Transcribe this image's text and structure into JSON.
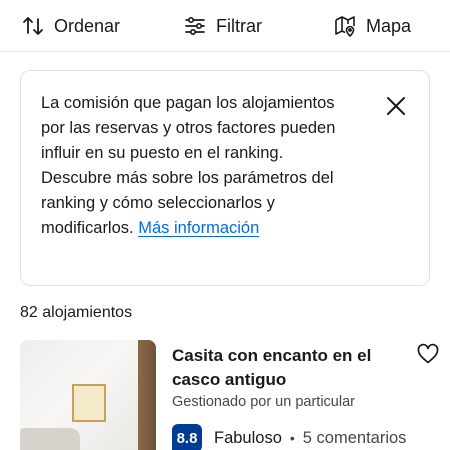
{
  "toolbar": {
    "sort_label": "Ordenar",
    "filter_label": "Filtrar",
    "map_label": "Mapa"
  },
  "notice": {
    "text": "La comisión que pagan los alojamientos por las reservas y otros factores pueden influir en su puesto en el ranking. Descubre más sobre los parámetros del ranking y cómo seleccionarlos y modificarlos.",
    "link_label": "Más información"
  },
  "results": {
    "count_label": "82 alojamientos"
  },
  "listing": {
    "title": "Casita con encanto en el casco antiguo",
    "host_type": "Gestionado por un particular",
    "score": "8.8",
    "score_word": "Fabuloso",
    "separator": "•",
    "reviews_label": "5 comentarios"
  },
  "colors": {
    "link": "#006ce4",
    "score_badge": "#003b95"
  }
}
